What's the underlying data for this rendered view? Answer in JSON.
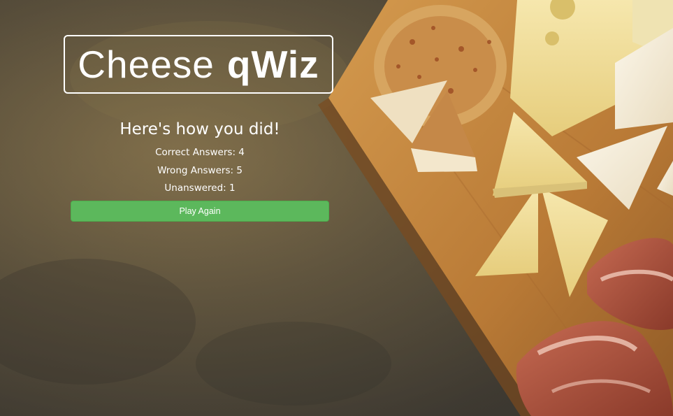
{
  "app": {
    "title_word_1": "Cheese",
    "title_word_2": "qWiz"
  },
  "results": {
    "heading": "Here's how you did!",
    "correct": "Correct Answers: 4",
    "wrong": "Wrong Answers: 5",
    "unanswered": "Unanswered: 1"
  },
  "actions": {
    "play_again_label": "Play Again"
  },
  "colors": {
    "button_green": "#5cb85c",
    "text": "#ffffff",
    "board": "#c98a3f",
    "cheese_yellow": "#f1dd9a"
  },
  "background": {
    "image": "cheese-board-photo"
  }
}
